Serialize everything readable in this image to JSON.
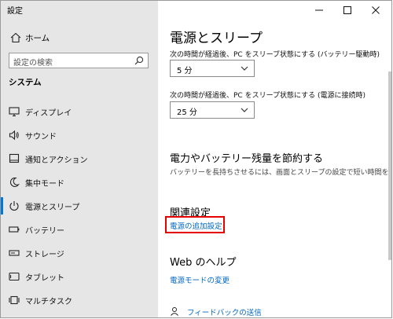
{
  "window": {
    "title": "設定"
  },
  "sidebar": {
    "home_label": "ホーム",
    "search_placeholder": "設定の検索",
    "section_title": "システム",
    "items": [
      {
        "label": "ディスプレイ",
        "icon": "monitor-icon"
      },
      {
        "label": "サウンド",
        "icon": "speaker-icon"
      },
      {
        "label": "通知とアクション",
        "icon": "notification-icon"
      },
      {
        "label": "集中モード",
        "icon": "moon-icon"
      },
      {
        "label": "電源とスリープ",
        "icon": "power-icon",
        "active": true
      },
      {
        "label": "バッテリー",
        "icon": "battery-icon"
      },
      {
        "label": "ストレージ",
        "icon": "storage-icon"
      },
      {
        "label": "タブレット",
        "icon": "tablet-icon"
      },
      {
        "label": "マルチタスク",
        "icon": "multitask-icon"
      }
    ]
  },
  "main": {
    "title": "電源とスリープ",
    "battery_sleep_label": "次の時間が経過後、PC をスリーブ状態にする (バッテリー駆動時)",
    "battery_sleep_value": "5 分",
    "plugged_sleep_label": "次の時間が経過後、PC をスリープ状態にする (電源に接続時)",
    "plugged_sleep_value": "25 分",
    "save_heading": "電力やバッテリー残量を節約する",
    "save_desc": "バッテリーを長持ちさせるには、画面とスリープの設定で短い時間を選択します。",
    "related_heading": "関連設定",
    "related_link": "電源の追加設定",
    "web_help_heading": "Web のヘルプ",
    "web_help_link": "電源モードの変更",
    "feedback_link": "フィードバックの送信"
  },
  "colors": {
    "accent": "#0078d7",
    "link": "#0067c0",
    "highlight": "#e60000",
    "sidebar_bg": "#e6e6e6"
  }
}
